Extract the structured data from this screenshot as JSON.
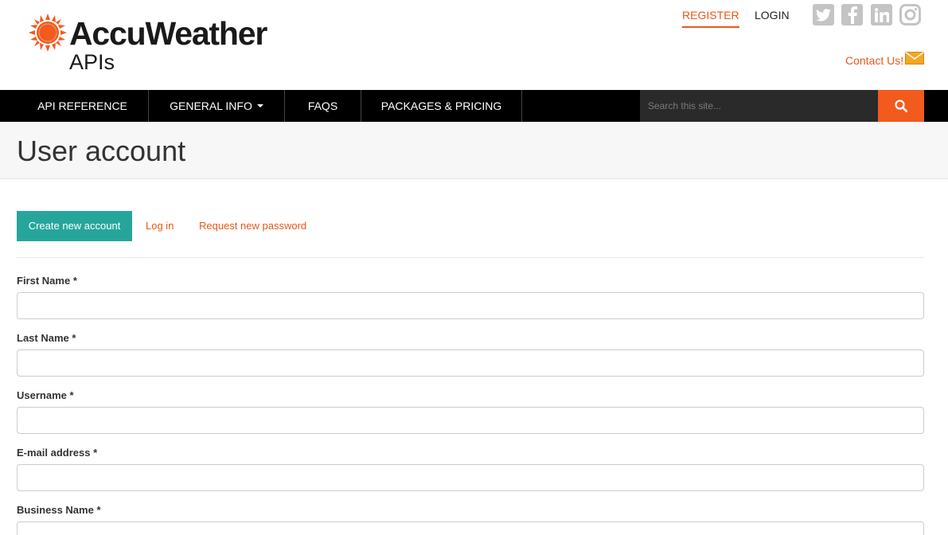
{
  "brand": {
    "name": "AccuWeather",
    "subtitle": "APIs",
    "colors": {
      "accent": "#e8581b",
      "teal": "#26a69a",
      "nav": "#000000",
      "search_btn": "#f25a1e"
    }
  },
  "header": {
    "register_label": "REGISTER",
    "login_label": "LOGIN",
    "social": [
      "twitter-icon",
      "facebook-icon",
      "linkedin-icon",
      "instagram-icon"
    ],
    "contact_label": "Contact Us!"
  },
  "nav": {
    "items": [
      {
        "label": "API REFERENCE"
      },
      {
        "label": "GENERAL INFO"
      },
      {
        "label": "FAQS"
      },
      {
        "label": "PACKAGES & PRICING"
      }
    ],
    "search": {
      "placeholder": "Search this site..."
    }
  },
  "page": {
    "title": "User account"
  },
  "tabs": {
    "create": "Create new account",
    "login": "Log in",
    "password": "Request new password"
  },
  "form": {
    "fields": [
      {
        "label": "First Name",
        "required": "*",
        "value": ""
      },
      {
        "label": "Last Name",
        "required": "*",
        "value": ""
      },
      {
        "label": "Username",
        "required": "*",
        "value": ""
      },
      {
        "label": "E-mail address",
        "required": "*",
        "value": ""
      },
      {
        "label": "Business Name",
        "required": "*",
        "value": ""
      }
    ]
  }
}
